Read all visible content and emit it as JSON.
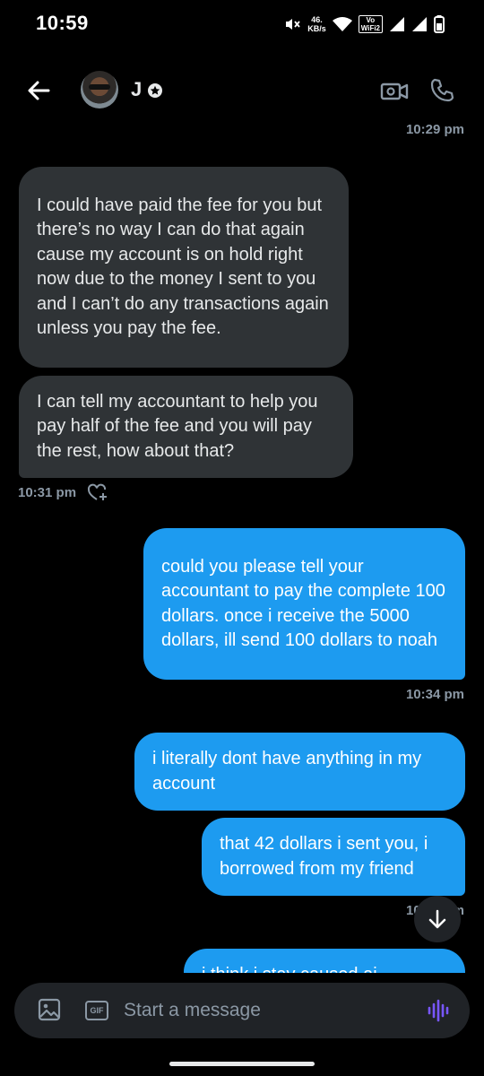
{
  "status_bar": {
    "time": "10:59",
    "net_speed": "46.",
    "net_unit": "KB/s",
    "vowifi_top": "Vo",
    "vowifi_bottom": "WiFi2"
  },
  "header": {
    "contact_name": "J",
    "back_icon": "arrow-left-icon",
    "badge_icon": "star-badge-icon",
    "video_icon": "video-camera-icon",
    "call_icon": "phone-icon"
  },
  "conversation": {
    "top_timestamp": "10:29 pm",
    "received": [
      {
        "text": "I could have paid the fee for you but there’s no way I can do that again cause my account is on hold right now due to the money I sent to you and I can’t do any transactions again unless you pay the fee."
      },
      {
        "text": "I can tell my accountant to help you pay half of the fee and you will pay the rest, how about that?"
      }
    ],
    "received_timestamp": "10:31 pm",
    "sent": [
      {
        "text": "could you please tell your accountant to pay the complete 100 dollars. once i receive the 5000 dollars, ill send 100 dollars to noah"
      },
      {
        "text": "i literally dont have anything in my account"
      },
      {
        "text": "that 42 dollars i sent you, i borrowed from my friend"
      },
      {
        "text": "i think i stay caused ai"
      }
    ],
    "sent_timestamp_1": "10:34 pm",
    "sent_timestamp_2": "10:35 pm"
  },
  "composer": {
    "placeholder": "Start a message",
    "gif_label": "GIF"
  },
  "colors": {
    "background": "#000000",
    "incoming_bubble": "#2f3336",
    "outgoing_bubble": "#1d9bf0",
    "secondary_text": "#8b98a5",
    "voice_accent": "#7856ff"
  }
}
